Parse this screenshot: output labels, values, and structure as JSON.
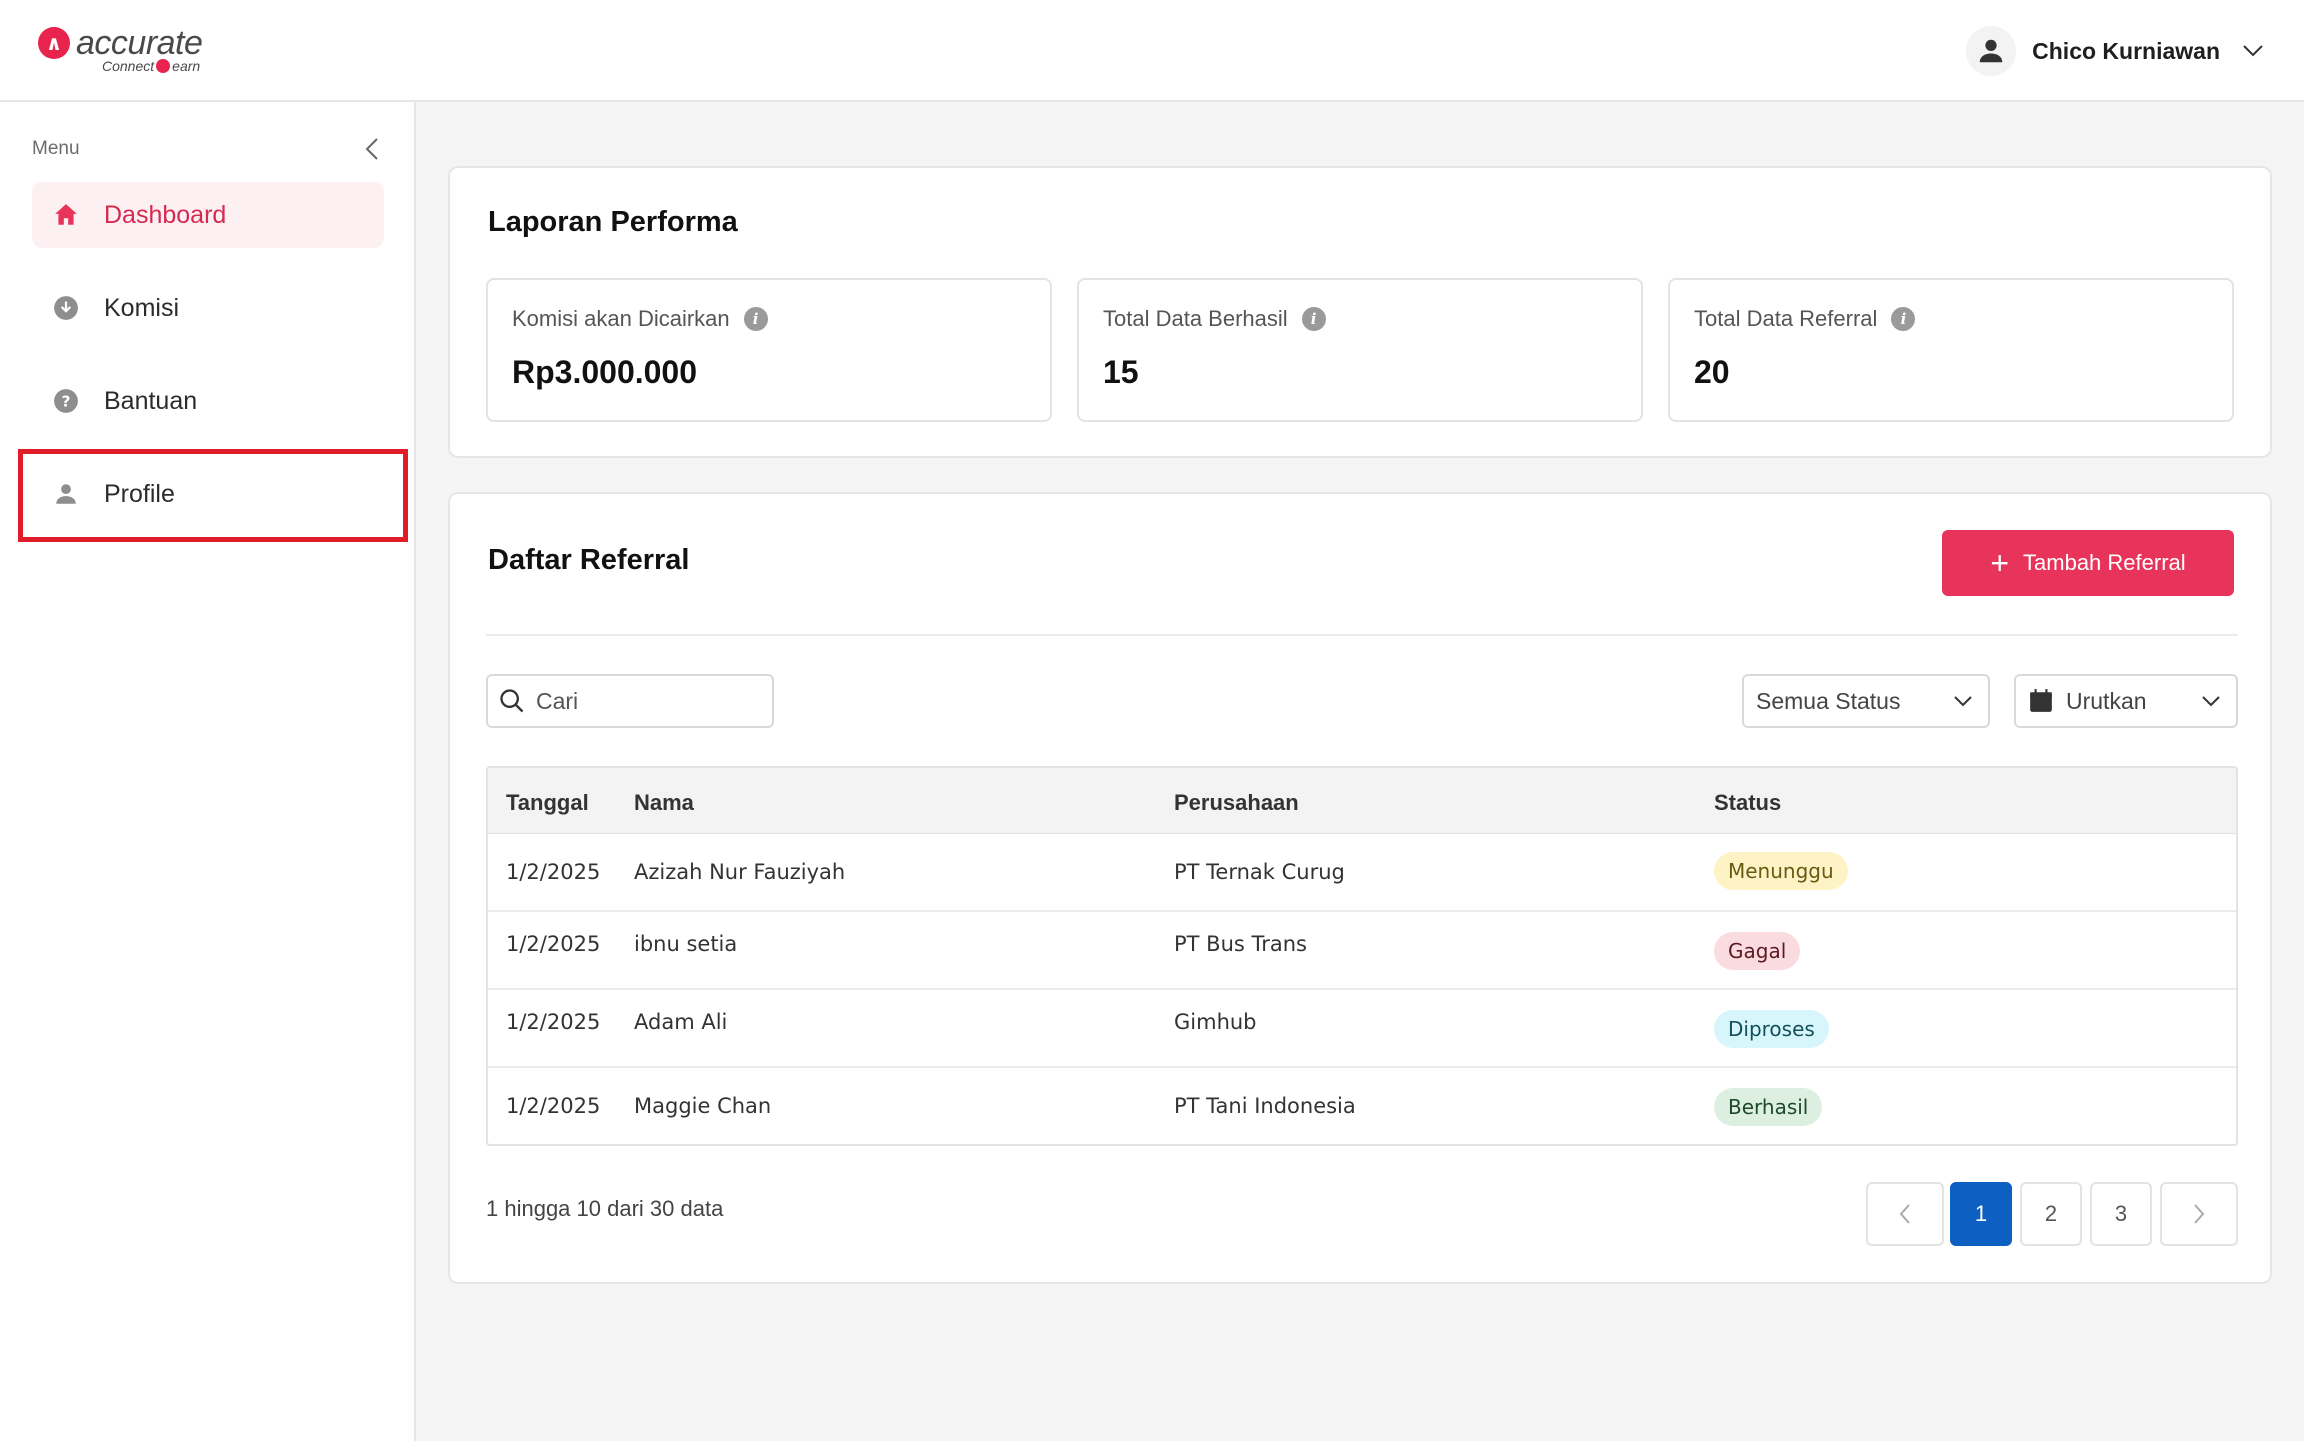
{
  "brand": {
    "name": "accurate",
    "tagline_left": "Connect",
    "tagline_right": "earn"
  },
  "header": {
    "user_name": "Chico Kurniawan"
  },
  "sidebar": {
    "menu_label": "Menu",
    "items": [
      {
        "label": "Dashboard",
        "icon": "home-icon"
      },
      {
        "label": "Komisi",
        "icon": "download-circle-icon"
      },
      {
        "label": "Bantuan",
        "icon": "help-circle-icon"
      },
      {
        "label": "Profile",
        "icon": "user-icon"
      }
    ]
  },
  "performance": {
    "title": "Laporan Performa",
    "stats": [
      {
        "label": "Komisi akan Dicairkan",
        "value": "Rp3.000.000"
      },
      {
        "label": "Total Data Berhasil",
        "value": "15"
      },
      {
        "label": "Total Data Referral",
        "value": "20"
      }
    ]
  },
  "referrals": {
    "title": "Daftar Referral",
    "add_button": "Tambah Referral",
    "search_placeholder": "Cari",
    "status_filter": "Semua Status",
    "sort_label": "Urutkan",
    "columns": {
      "date": "Tanggal",
      "name": "Nama",
      "company": "Perusahaan",
      "status": "Status"
    },
    "rows": [
      {
        "date": "1/2/2025",
        "name": "Azizah Nur Fauziyah",
        "company": "PT Ternak Curug",
        "status": "Menunggu"
      },
      {
        "date": "1/2/2025",
        "name": "ibnu setia",
        "company": "PT Bus Trans",
        "status": "Gagal"
      },
      {
        "date": "1/2/2025",
        "name": "Adam Ali",
        "company": "Gimhub",
        "status": "Diproses"
      },
      {
        "date": "1/2/2025",
        "name": "Maggie Chan",
        "company": "PT Tani Indonesia",
        "status": "Berhasil"
      }
    ],
    "pagination_text": "1 hingga 10 dari 30 data",
    "pages": [
      "1",
      "2",
      "3"
    ]
  },
  "colors": {
    "accent": "#e8345a",
    "pager_active": "#0e5fc2",
    "status_menunggu_bg": "#fdf3c4",
    "status_gagal_bg": "#fadbdf",
    "status_diproses_bg": "#d7f6fb",
    "status_berhasil_bg": "#dcefe1"
  }
}
